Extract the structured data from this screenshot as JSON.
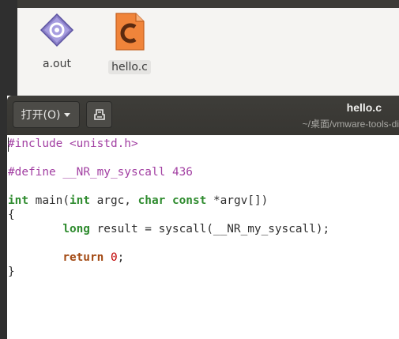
{
  "file_manager": {
    "files": [
      {
        "name": "a.out",
        "icon": "executable-file-icon"
      },
      {
        "name": "hello.c",
        "icon": "c-source-file-icon"
      }
    ]
  },
  "editor": {
    "open_label": "打开(O)",
    "title": "hello.c",
    "subtitle": "~/桌面/vmware-tools-di",
    "code": {
      "include_dir": "#include",
      "include_file": "<unistd.h>",
      "define_dir": "#define",
      "define_name": "__NR_my_syscall",
      "define_value": "436",
      "int_kw": "int",
      "main_sig1": " main(",
      "int_kw2": "int",
      "argc": " argc, ",
      "char_kw": "char",
      "sp": " ",
      "const_kw": "const",
      "argv": " *argv[])",
      "open_brace": "{",
      "indent": "        ",
      "long_kw": "long",
      "syscall_line": " result = syscall(__NR_my_syscall);",
      "return_kw": "return",
      "ret_sp": " ",
      "ret_val": "0",
      "semi": ";",
      "close_brace": "}"
    }
  }
}
